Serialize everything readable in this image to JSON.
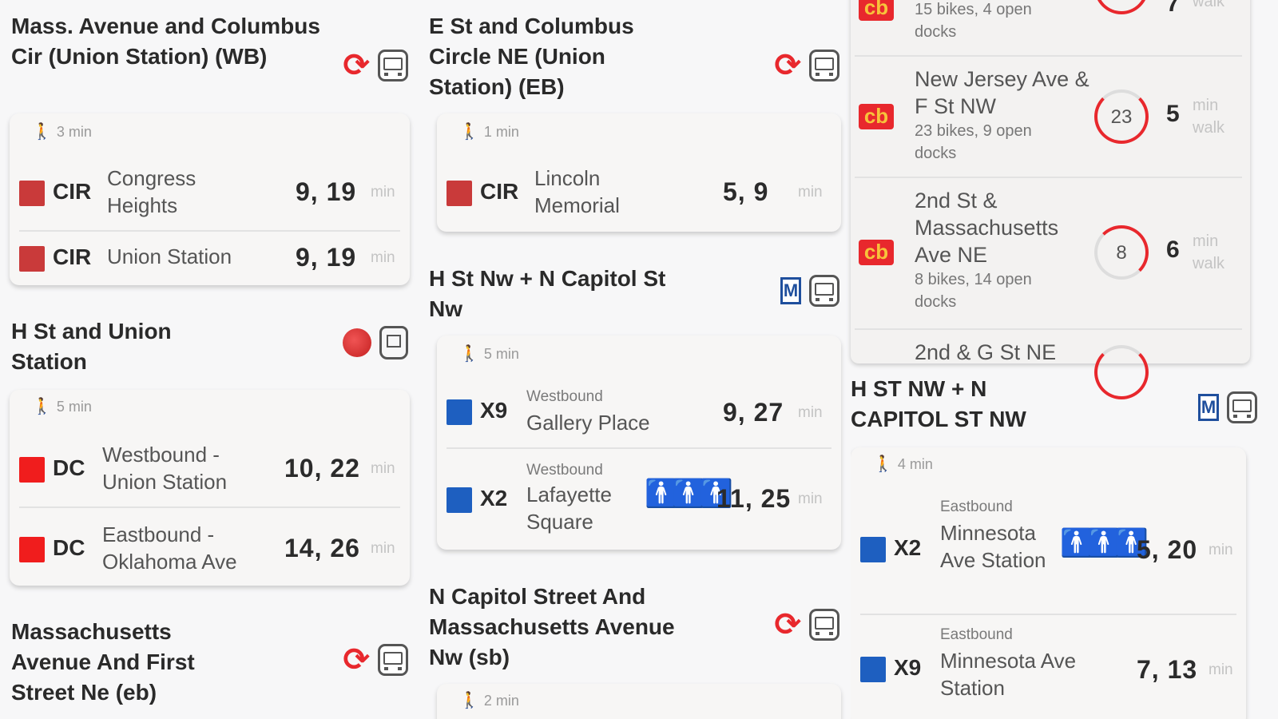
{
  "stops": {
    "mass_union_wb": {
      "title": "Mass. Avenue and Columbus Cir (Union Station) (WB)",
      "walk": "3 min",
      "routes": [
        {
          "name": "CIR",
          "dest": "Congress Heights",
          "times": "9,  19",
          "unit": "min",
          "color": "#c93a3a"
        },
        {
          "name": "CIR",
          "dest": "Union Station",
          "times": "9,  19",
          "unit": "min",
          "color": "#c93a3a"
        }
      ]
    },
    "h_union": {
      "title": "H St and Union Station",
      "walk": "5 min",
      "routes": [
        {
          "name": "DC",
          "dest": "Westbound - Union Station",
          "times": "10,  22",
          "unit": "min",
          "color": "#f01d1d"
        },
        {
          "name": "DC",
          "dest": "Eastbound - Oklahoma Ave",
          "times": "14,  26",
          "unit": "min",
          "color": "#f01d1d"
        }
      ]
    },
    "mass_first_eb": {
      "title": "Massachusetts Avenue And First Street Ne (eb)"
    },
    "e_columbus_eb": {
      "title": "E St and Columbus Circle NE (Union Station) (EB)",
      "walk": "1 min",
      "routes": [
        {
          "name": "CIR",
          "dest": "Lincoln Memorial",
          "times": "5,    9",
          "unit": "min",
          "color": "#c93a3a"
        }
      ]
    },
    "h_capitol": {
      "title": "H St Nw + N Capitol St Nw",
      "walk": "5 min",
      "routes": [
        {
          "name": "X9",
          "dir": "Westbound",
          "dest": "Gallery Place",
          "times": "9,  27",
          "unit": "min",
          "color": "#1e5fc0"
        },
        {
          "name": "X2",
          "dir": "Westbound",
          "dest": "Lafayette Square",
          "times": "11,  25",
          "unit": "min",
          "color": "#1e5fc0"
        }
      ]
    },
    "n_capitol_mass_sb": {
      "title": "N Capitol Street And Massachusetts Avenue Nw (sb)",
      "walk": "2 min"
    },
    "h_capitol_upper": {
      "title": "H ST NW + N CAPITOL ST NW",
      "walk": "4 min",
      "routes": [
        {
          "name": "X2",
          "dir": "Eastbound",
          "dest": "Minnesota Ave Station",
          "times": "5,  20",
          "unit": "min",
          "color": "#1e5fc0"
        },
        {
          "name": "X9",
          "dir": "Eastbound",
          "dest": "Minnesota Ave Station",
          "times": "7,   13",
          "unit": "min",
          "color": "#1e5fc0"
        }
      ]
    }
  },
  "bikes": [
    {
      "name": "",
      "sub": "15 bikes, 4 open docks",
      "count": "",
      "walk_min": "7",
      "unit": "walk"
    },
    {
      "name": "New Jersey Ave & F St NW",
      "sub": "23 bikes, 9 open docks",
      "count": "23",
      "walk_min": "5",
      "unit": "min walk"
    },
    {
      "name": "2nd St & Massachusetts Ave NE",
      "sub": "8 bikes, 14 open docks",
      "count": "8",
      "walk_min": "6",
      "unit": "min walk"
    },
    {
      "name": "2nd & G St NE",
      "sub": "",
      "count": "",
      "walk_min": "",
      "unit": ""
    }
  ],
  "icons": {
    "refresh": "refresh-icon",
    "bus": "bus-icon",
    "metro": "metro-icon",
    "streetcar": "streetcar-icon",
    "dc_circulator": "dc-circulator-icon",
    "walk": "walk-icon",
    "crowding": "crowding-icon",
    "capital_bikeshare": "capital-bikeshare-icon"
  },
  "colors": {
    "refresh": "#e8282d",
    "circulator": "#c93a3a",
    "dc_streetcar": "#f01d1d",
    "metrobus": "#1e5fc0",
    "bikeshare": "#e8282d"
  }
}
